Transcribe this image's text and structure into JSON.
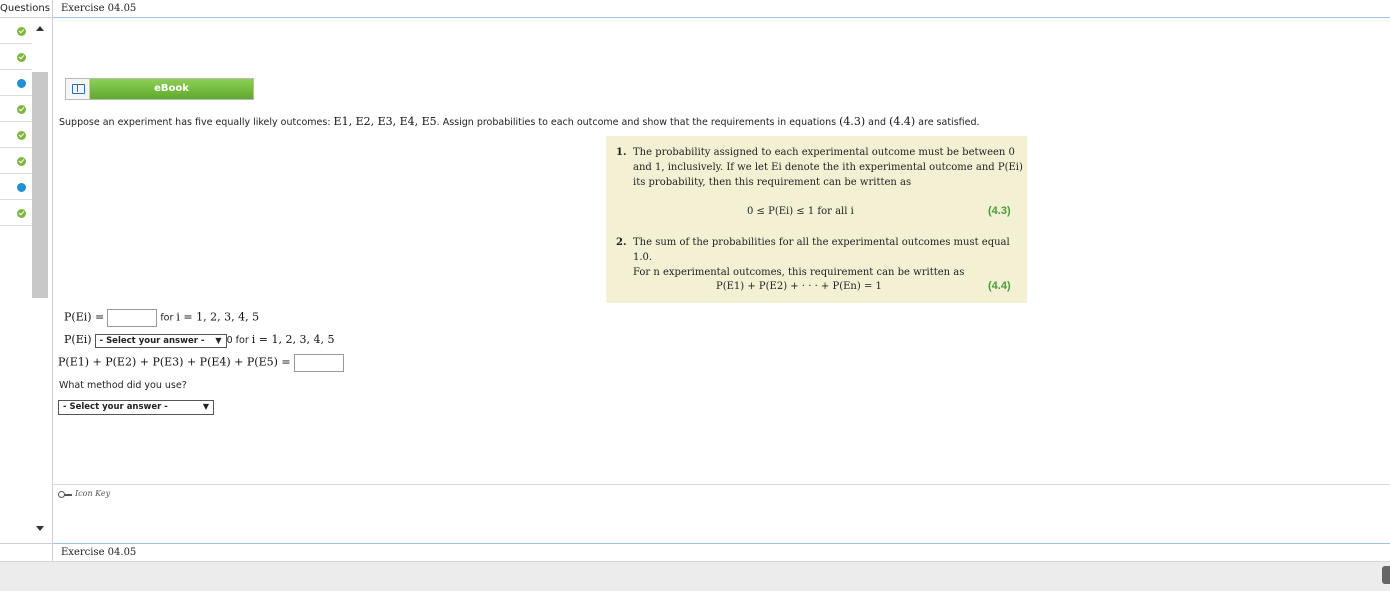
{
  "sidebar": {
    "header": "Questions",
    "rows": [
      {
        "status": "done"
      },
      {
        "status": "done"
      },
      {
        "status": "current"
      },
      {
        "status": "done"
      },
      {
        "status": "done"
      },
      {
        "status": "done"
      },
      {
        "status": "current"
      },
      {
        "status": "done"
      }
    ]
  },
  "header": {
    "title": "Exercise 04.05"
  },
  "footer": {
    "title": "Exercise 04.05"
  },
  "ebook": {
    "label": "eBook"
  },
  "prompt": {
    "before": "Suppose an experiment has five equally likely outcomes: ",
    "outcomes": "E1, E2, E3, E4, E5",
    "middle": ". Assign probabilities to each outcome and show that the requirements in equations ",
    "eq1": "(4.3)",
    "and": " and ",
    "eq2": "(4.4)",
    "after": " are satisfied."
  },
  "requirements": {
    "item1_num": "1.",
    "item1_line1": "The probability assigned to each experimental outcome must be between 0",
    "item1_line2": "and 1, inclusively. If we let Ei denote the ith experimental outcome and P(Ei)",
    "item1_line3": "its probability, then this requirement can be written as",
    "eq1": "0 ≤ P(Ei) ≤ 1 for all i",
    "eq1_no": "(4.3)",
    "item2_num": "2.",
    "item2_line1": "The sum of the probabilities for all the experimental outcomes must equal 1.0.",
    "item2_line2": "For n experimental outcomes, this requirement can be written as",
    "eq2": "P(E1) + P(E2) + · · · + P(En) = 1",
    "eq2_no": "(4.4)"
  },
  "answers": {
    "row1_lhs": "P(Ei) =",
    "row1_input": "",
    "row1_for": "for",
    "row1_range": "i = 1, 2, 3, 4, 5",
    "row2_lhs": "P(Ei)",
    "row2_select": "- Select your answer -",
    "row2_zero": "0",
    "row2_for": "for",
    "row2_range": "i = 1, 2, 3, 4, 5",
    "row3_lhs": "P(E1) + P(E2) + P(E3) + P(E4) + P(E5) =",
    "row3_input": ""
  },
  "method": {
    "label": "What method did you use?",
    "select": "- Select your answer -"
  },
  "icon_key": {
    "label": "Icon Key"
  }
}
